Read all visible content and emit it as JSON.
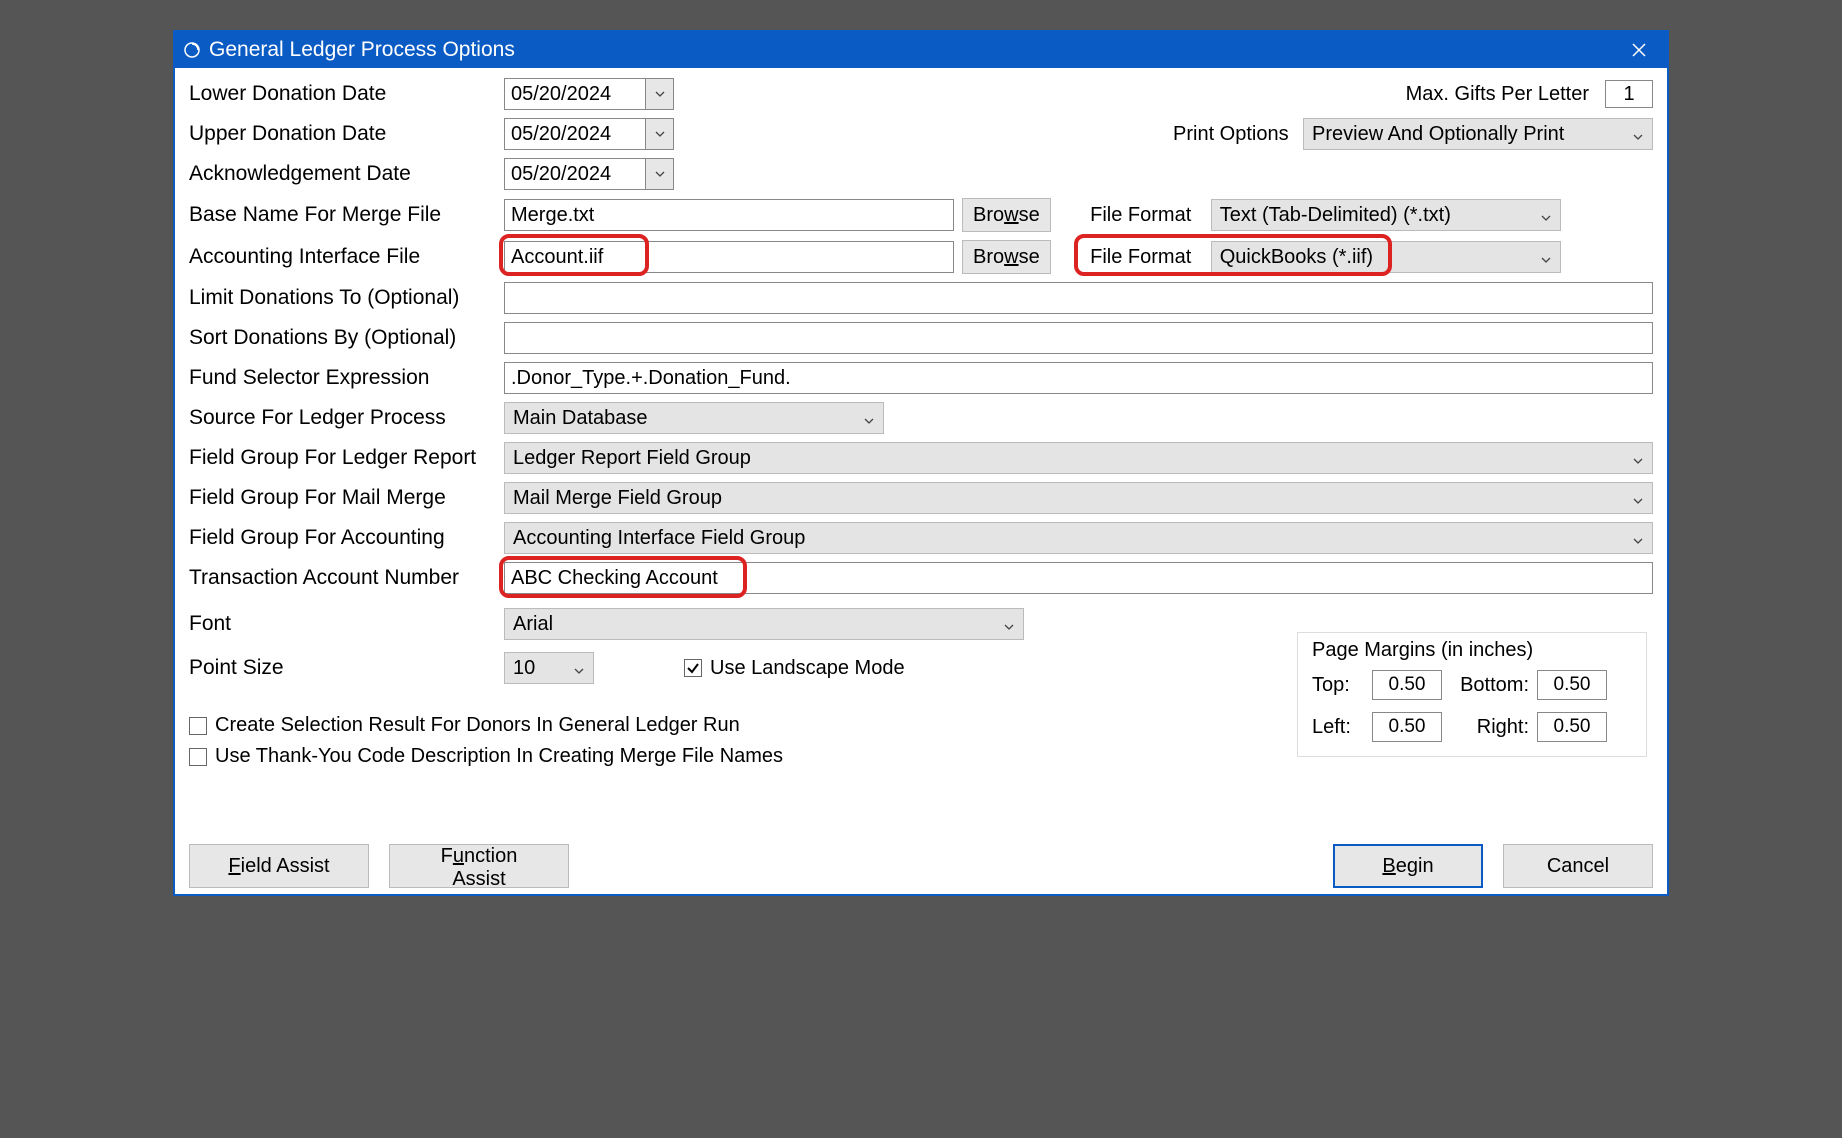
{
  "window": {
    "title": "General Ledger Process Options"
  },
  "labels": {
    "lower_date": "Lower Donation Date",
    "upper_date": "Upper Donation Date",
    "ack_date": "Acknowledgement Date",
    "base_merge": "Base Name For Merge File",
    "acct_file": "Accounting Interface File",
    "limit": "Limit Donations To (Optional)",
    "sort": "Sort Donations By (Optional)",
    "fund_sel": "Fund Selector Expression",
    "source": "Source For Ledger Process",
    "fg_report": "Field Group For Ledger Report",
    "fg_merge": "Field Group For Mail Merge",
    "fg_acct": "Field Group For Accounting",
    "trans_acct": "Transaction Account Number",
    "font": "Font",
    "point_size": "Point Size",
    "max_gifts": "Max. Gifts Per Letter",
    "print_options": "Print Options",
    "file_format1": "File Format",
    "file_format2": "File Format",
    "landscape": "Use Landscape Mode",
    "margins_title": "Page Margins (in inches)",
    "top": "Top:",
    "bottom": "Bottom:",
    "left": "Left:",
    "right": "Right:"
  },
  "values": {
    "lower_date": "05/20/2024",
    "upper_date": "05/20/2024",
    "ack_date": "05/20/2024",
    "base_merge": "Merge.txt",
    "acct_file": "Account.iif",
    "limit": "",
    "sort": "",
    "fund_sel": ".Donor_Type.+.Donation_Fund.",
    "source": "Main Database",
    "fg_report": "Ledger Report Field Group",
    "fg_merge": "Mail Merge Field Group",
    "fg_acct": "Accounting Interface Field Group",
    "trans_acct": "ABC Checking Account",
    "font": "Arial",
    "point_size": "10",
    "max_gifts": "1",
    "print_options": "Preview And Optionally Print",
    "file_format1": "Text (Tab-Delimited) (*.txt)",
    "file_format2": "QuickBooks (*.iif)",
    "margin_top": "0.50",
    "margin_bottom": "0.50",
    "margin_left": "0.50",
    "margin_right": "0.50"
  },
  "buttons": {
    "browse": "Browse",
    "field_assist": "Field Assist",
    "function_assist": "Function Assist",
    "begin": "Begin",
    "cancel": "Cancel"
  },
  "checkboxes": {
    "landscape_checked": "true",
    "create_selection": "Create Selection Result For Donors In General Ledger Run",
    "thankyou_code": "Use Thank-You Code Description In Creating Merge File Names"
  }
}
